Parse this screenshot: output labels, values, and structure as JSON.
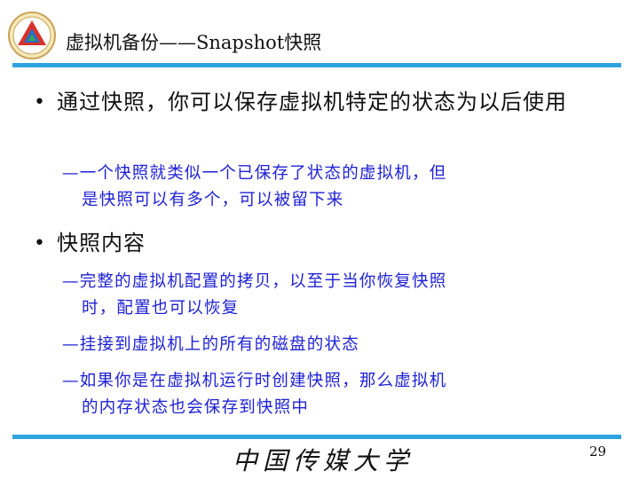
{
  "header": {
    "title": "虚拟机备份——Snapshot快照",
    "logo_icon": "university-emblem-icon",
    "accent_color": "#2ea3dd"
  },
  "bullets": [
    {
      "text": "通过快照，你可以保存虚拟机特定的状态为以后使用",
      "subs": [
        {
          "line1": "—一个快照就类似一个已保存了状态的虚拟机，但",
          "line2": "是快照可以有多个，可以被留下来"
        }
      ]
    },
    {
      "text": "快照内容",
      "subs": [
        {
          "line1": "—完整的虚拟机配置的拷贝，以至于当你恢复快照",
          "line2": "时，配置也可以恢复"
        },
        {
          "line1": "—挂接到虚拟机上的所有的磁盘的状态",
          "line2": ""
        },
        {
          "line1": "—如果你是在虚拟机运行时创建快照，那么虚拟机",
          "line2": "的内存状态也会保存到快照中"
        }
      ]
    }
  ],
  "footer": {
    "university": "中国传媒大学",
    "page_number": "29"
  },
  "colors": {
    "sub_text": "#1f21d6",
    "rule": "#2ea3dd"
  }
}
